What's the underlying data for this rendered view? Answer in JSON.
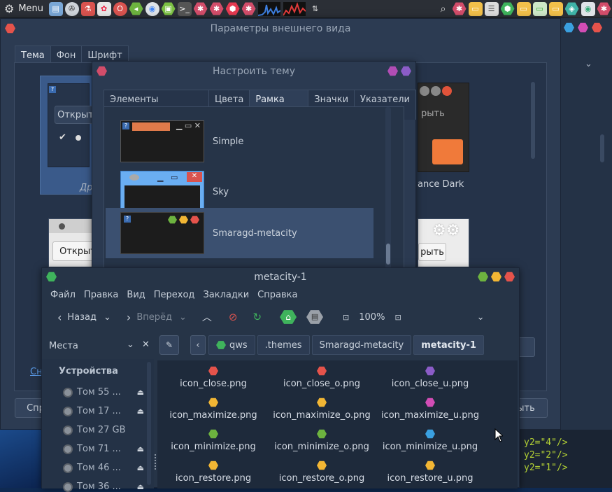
{
  "panel": {
    "menu_label": "Menu"
  },
  "appearance": {
    "title": "Параметры внешнего вида",
    "tabs": [
      "Тема",
      "Фон",
      "Шрифт"
    ],
    "thumb1_open": "Открыт",
    "thumb1_label": "Дру",
    "thumb2_open": "Открыт",
    "right_thumb1_btn": "рыть",
    "right_thumb1_label": "ance Dark",
    "right_thumb2_btn": "рыть",
    "link_partial": "Сн",
    "bottom_left_btn": "Спр",
    "bottom_right_btn": "ыть"
  },
  "customize": {
    "title": "Настроить тему",
    "tabs": [
      "Элементы управления",
      "Цвета",
      "Рамка окна",
      "Значки",
      "Указатели"
    ],
    "active_tab": "Рамка окна",
    "themes": [
      "Simple",
      "Sky",
      "Smaragd-metacity"
    ]
  },
  "fm": {
    "title": "metacity-1",
    "menu": [
      "Файл",
      "Правка",
      "Вид",
      "Переход",
      "Закладки",
      "Справка"
    ],
    "back_label": "Назад",
    "forward_label": "Вперёд",
    "zoom": "100%",
    "sidebar_header": "Места",
    "devices_header": "Устройства",
    "devices": [
      "Том 55 ...",
      "Том 17 ...",
      "Том 27 GB",
      "Том 71 ...",
      "Том 46 ...",
      "Том 36 ..."
    ],
    "crumbs": [
      "qws",
      ".themes",
      "Smaragd-metacity",
      "metacity-1"
    ],
    "files": [
      {
        "name": "icon_close.png",
        "color": "#e5534b"
      },
      {
        "name": "icon_close_o.png",
        "color": "#e5534b"
      },
      {
        "name": "icon_close_u.png",
        "color": "#8b5cc7"
      },
      {
        "name": "icon_maximize.png",
        "color": "#f2b634"
      },
      {
        "name": "icon_maximize_o.png",
        "color": "#f2b634"
      },
      {
        "name": "icon_maximize_u.png",
        "color": "#d24db5"
      },
      {
        "name": "icon_minimize.png",
        "color": "#6db33f"
      },
      {
        "name": "icon_minimize_o.png",
        "color": "#6db33f"
      },
      {
        "name": "icon_minimize_u.png",
        "color": "#3aa0e0"
      },
      {
        "name": "icon_restore.png",
        "color": "#f2b634"
      },
      {
        "name": "icon_restore_o.png",
        "color": "#f2b634"
      },
      {
        "name": "icon_restore_u.png",
        "color": "#f2b634"
      }
    ]
  },
  "code": {
    "lines": [
      "y2=\"4\"/>",
      "y2=\"2\"/>",
      "y2=\"1\"/>"
    ]
  }
}
